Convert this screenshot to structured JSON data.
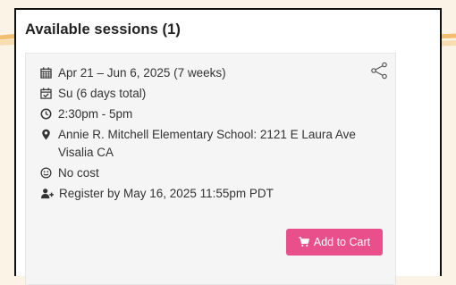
{
  "panel": {
    "title": "Available sessions (1)"
  },
  "session": {
    "dates": "Apr 21 – Jun 6, 2025 (7 weeks)",
    "days": "Su (6 days total)",
    "time": "2:30pm - 5pm",
    "location": "Annie R. Mitchell Elementary School: 2121 E Laura Ave Visalia CA",
    "cost": "No cost",
    "register_by": "Register by May 16, 2025 11:55pm PDT",
    "cart_label": "Add to Cart"
  },
  "icons": {
    "share": "share-icon",
    "dates": "calendar-icon",
    "days": "calendar-check-icon",
    "time": "clock-icon",
    "location": "map-marker-icon",
    "cost": "smile-icon",
    "register": "user-plus-icon",
    "cart": "shopping-cart-icon"
  },
  "colors": {
    "cart_button": "#e94f8a",
    "page_background": "#fbf4e6",
    "accent_curve": "#f2b45a"
  }
}
